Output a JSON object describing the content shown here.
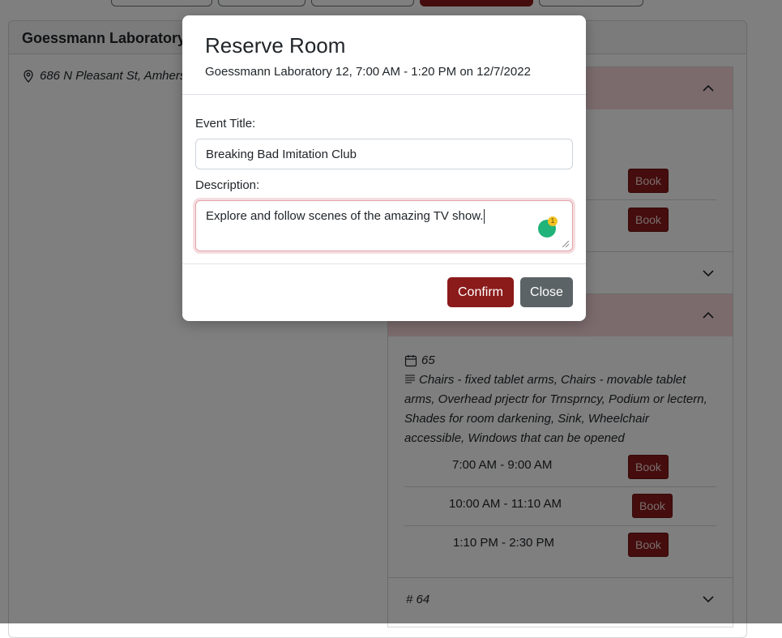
{
  "page": {
    "card_title": "Goessmann Laboratory",
    "address": "686 N Pleasant St, Amherst"
  },
  "accordion": {
    "top_section": {
      "slots": [
        {
          "book_label": "Book"
        },
        {
          "book_label": "Book"
        }
      ]
    },
    "room": {
      "capacity": "65",
      "features": "Chairs - fixed tablet arms, Chairs - movable tablet arms, Overhead prjectr for Trnsprncy, Podium or lectern, Shades for room darkening, Sink, Wheelchair accessible, Windows that can be opened",
      "slots": [
        {
          "time": "7:00 AM - 9:00 AM",
          "book_label": "Book"
        },
        {
          "time": "10:00 AM - 11:10 AM",
          "book_label": "Book"
        },
        {
          "time": "1:10 PM - 2:30 PM",
          "book_label": "Book"
        }
      ]
    },
    "next_room_label": "# 64"
  },
  "modal": {
    "title": "Reserve Room",
    "subtitle": "Goessmann Laboratory 12, 7:00 AM - 1:20 PM on 12/7/2022",
    "event_title_label": "Event Title:",
    "event_title_value": "Breaking Bad Imitation Club",
    "description_label": "Description:",
    "description_value": "Explore and follow scenes of the amazing TV show.",
    "assistant_badge_count": "1",
    "confirm_label": "Confirm",
    "close_label": "Close"
  },
  "colors": {
    "primary": "#8b1a1a",
    "secondary": "#5c6366",
    "accordion_open": "#f8d7da"
  }
}
